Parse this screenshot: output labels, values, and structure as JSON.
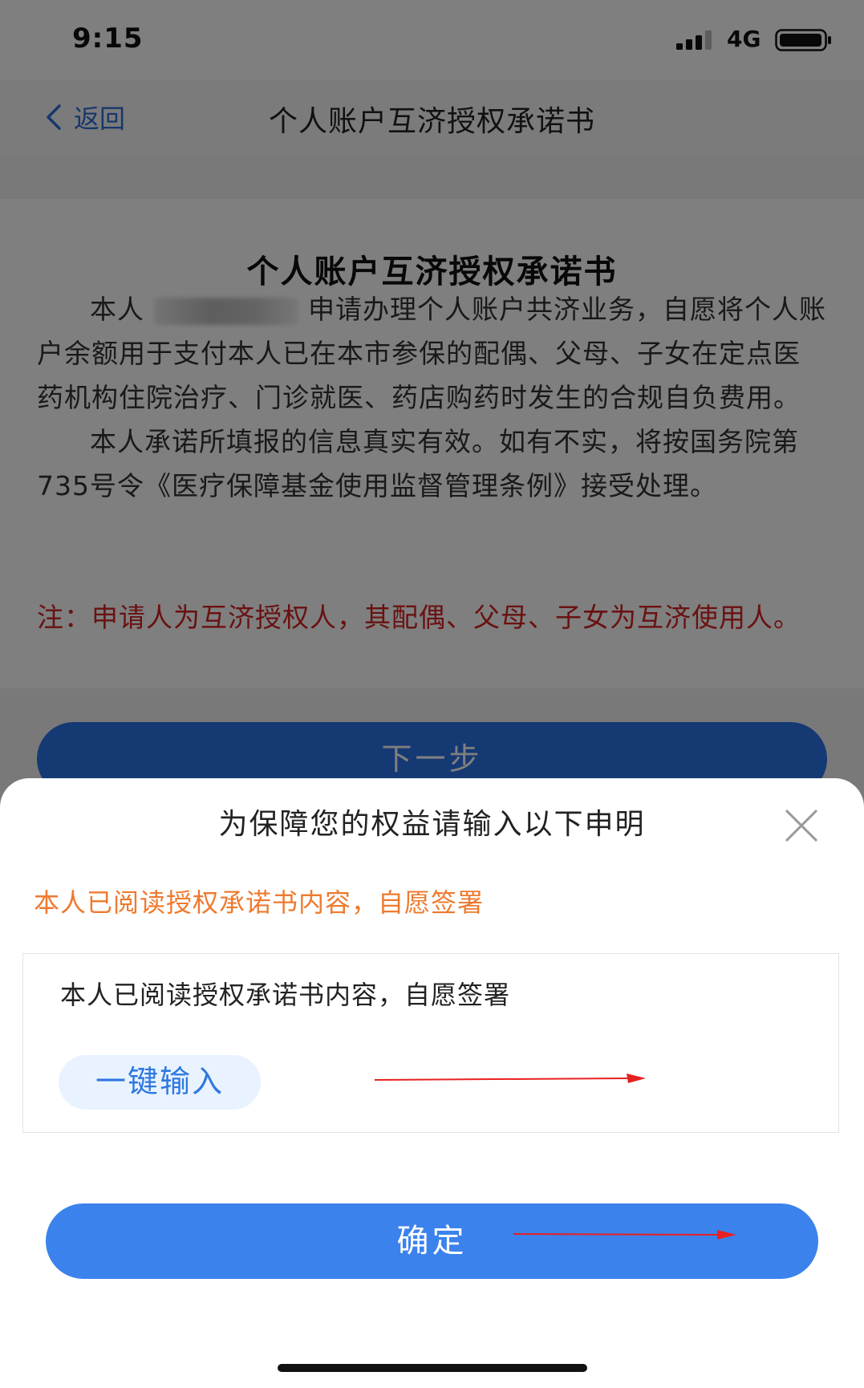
{
  "status_bar": {
    "time": "9:15",
    "network": "4G"
  },
  "nav": {
    "back_label": "返回",
    "title": "个人账户互济授权承诺书"
  },
  "document": {
    "title": "个人账户互济授权承诺书",
    "para1_prefix": "本人",
    "para1_rest": "申请办理个人账户共济业务，自愿将个人账户余额用于支付本人已在本市参保的配偶、父母、子女在定点医药机构住院治疗、门诊就医、药店购药时发生的合规自负费用。",
    "para2": "本人承诺所填报的信息真实有效。如有不实，将按国务院第735号令《医疗保障基金使用监督管理条例》接受处理。",
    "note": "注：申请人为互济授权人，其配偶、父母、子女为互济使用人。"
  },
  "next_button": "下一步",
  "sheet": {
    "title": "为保障您的权益请输入以下申明",
    "required_statement": "本人已阅读授权承诺书内容，自愿签署",
    "input_value": "本人已阅读授权承诺书内容，自愿签署",
    "one_click_label": "一键输入",
    "confirm_label": "确定"
  },
  "colors": {
    "accent_blue": "#3b82ec",
    "warning_orange": "#ee7a2f",
    "note_red": "#d42323",
    "annotation_arrow": "#e82020"
  },
  "icons": [
    "signal-icon",
    "battery-icon",
    "back-chevron-icon",
    "close-icon",
    "arrow-annotation-icon"
  ]
}
